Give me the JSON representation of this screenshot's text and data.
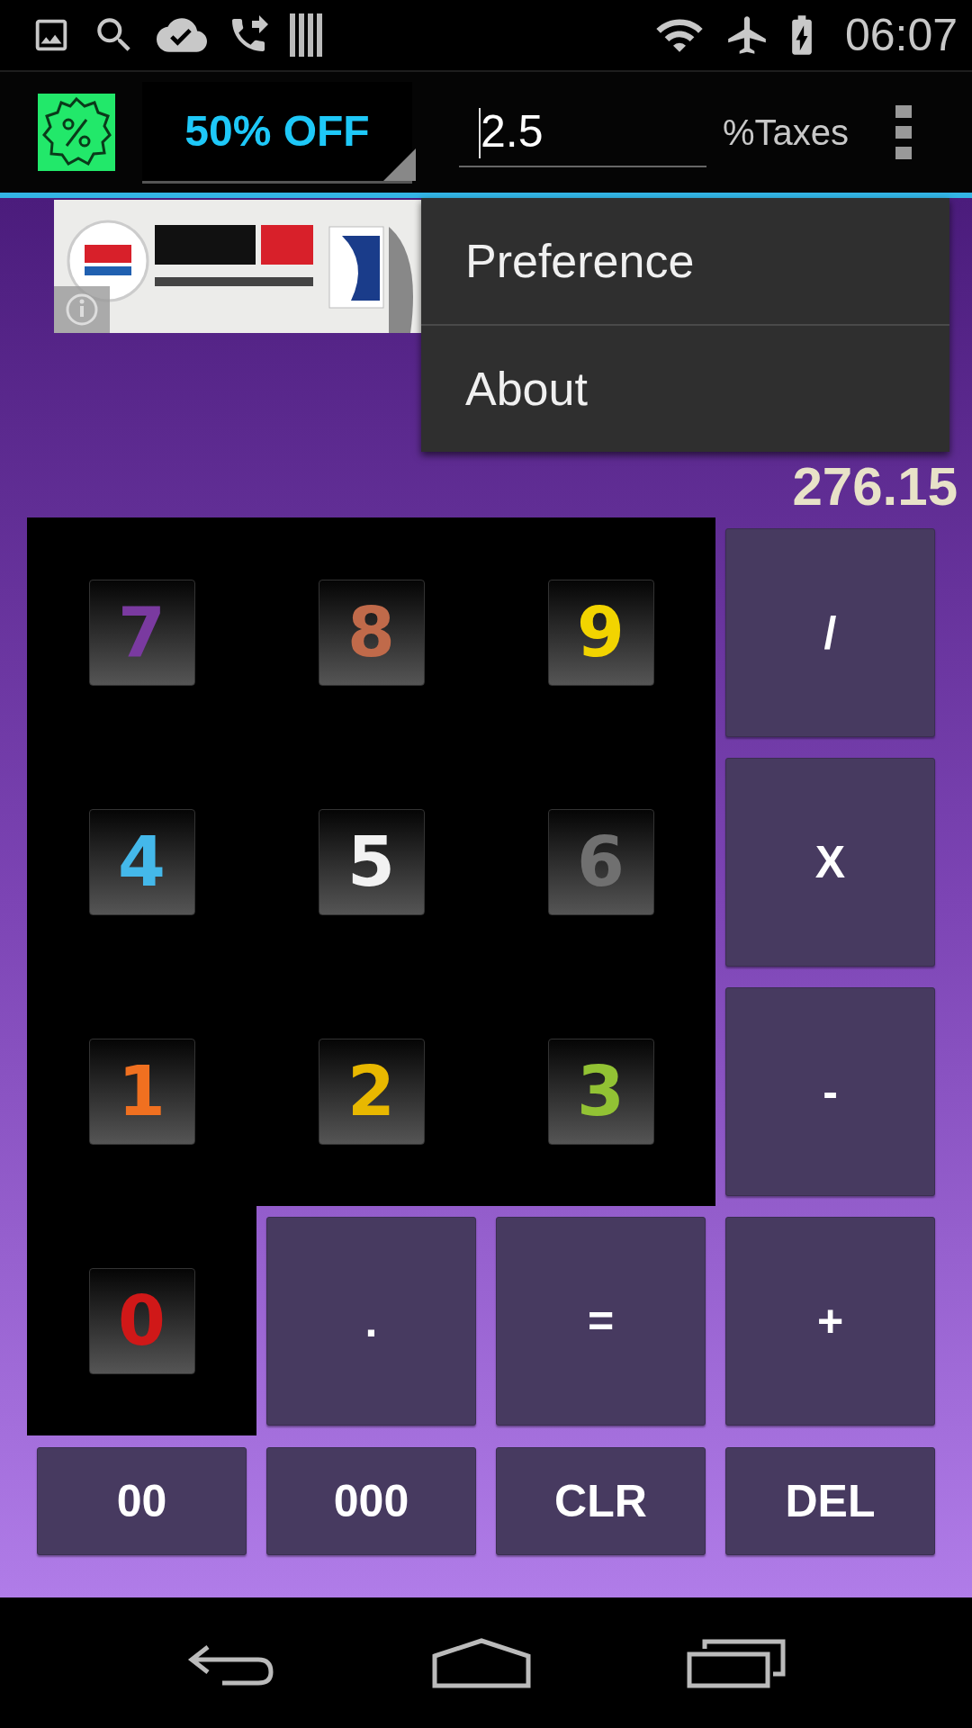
{
  "status_bar": {
    "time": "06:07"
  },
  "toolbar": {
    "discount": "50% OFF",
    "tax_field": {
      "value": "2.5"
    },
    "tax_label": "%Taxes"
  },
  "menu": {
    "items": [
      {
        "label": "Preference"
      },
      {
        "label": "About"
      }
    ]
  },
  "display": {
    "lines": [
      "276.15"
    ]
  },
  "keys": [
    {
      "label": "7",
      "kind": "digit",
      "color": "#7a3aa0"
    },
    {
      "label": "8",
      "kind": "digit",
      "color": "#c06a4a"
    },
    {
      "label": "9",
      "kind": "digit",
      "color": "#f2d400"
    },
    {
      "label": "/",
      "kind": "operator"
    },
    {
      "label": "4",
      "kind": "digit",
      "color": "#44b8ea"
    },
    {
      "label": "5",
      "kind": "digit",
      "color": "#f2f2f2"
    },
    {
      "label": "6",
      "kind": "digit",
      "color": "#707070"
    },
    {
      "label": "X",
      "kind": "operator"
    },
    {
      "label": "1",
      "kind": "digit",
      "color": "#f07020"
    },
    {
      "label": "2",
      "kind": "digit",
      "color": "#e8b800"
    },
    {
      "label": "3",
      "kind": "digit",
      "color": "#92c234"
    },
    {
      "label": "-",
      "kind": "operator"
    },
    {
      "label": "0",
      "kind": "digit",
      "color": "#d01818"
    },
    {
      "label": ".",
      "kind": "operator"
    },
    {
      "label": "=",
      "kind": "operator"
    },
    {
      "label": "+",
      "kind": "operator"
    },
    {
      "label": "00",
      "kind": "operator"
    },
    {
      "label": "000",
      "kind": "operator"
    },
    {
      "label": "CLR",
      "kind": "operator"
    },
    {
      "label": "DEL",
      "kind": "operator"
    }
  ]
}
